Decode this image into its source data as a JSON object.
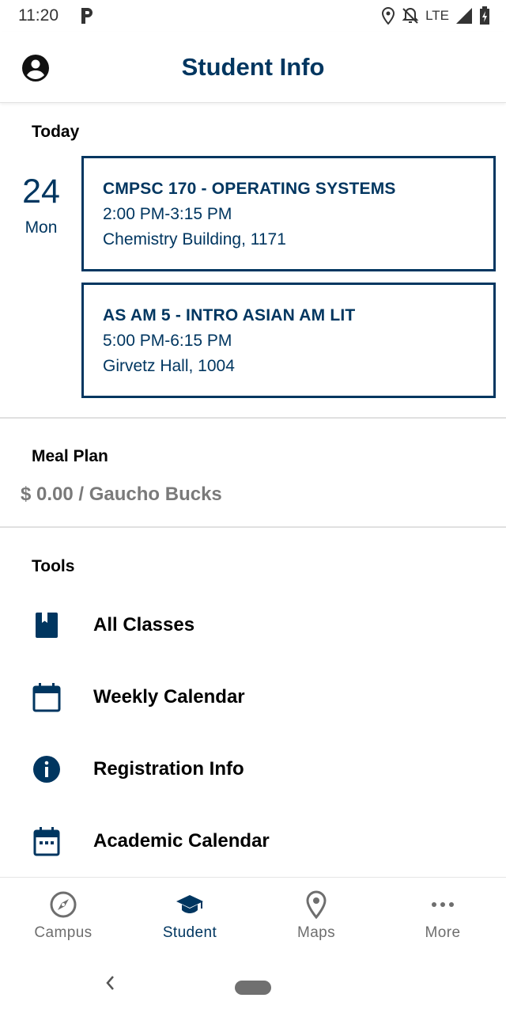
{
  "status_bar": {
    "time": "11:20",
    "network": "LTE"
  },
  "app_bar": {
    "title": "Student Info"
  },
  "today": {
    "heading": "Today",
    "date_number": "24",
    "date_day": "Mon",
    "classes": [
      {
        "title": "CMPSC 170 - OPERATING SYSTEMS",
        "time": "2:00 PM-3:15 PM",
        "location": "Chemistry Building, 1171"
      },
      {
        "title": "AS AM 5 - INTRO ASIAN AM LIT",
        "time": "5:00 PM-6:15 PM",
        "location": "Girvetz Hall, 1004"
      }
    ]
  },
  "meal_plan": {
    "heading": "Meal Plan",
    "balance": "$  0.00 / Gaucho Bucks"
  },
  "tools": {
    "heading": "Tools",
    "items": [
      {
        "label": "All Classes",
        "icon": "book-icon"
      },
      {
        "label": "Weekly Calendar",
        "icon": "calendar-icon"
      },
      {
        "label": "Registration Info",
        "icon": "info-icon"
      },
      {
        "label": "Academic Calendar",
        "icon": "calendar-dots-icon"
      }
    ]
  },
  "bottom_nav": {
    "items": [
      {
        "label": "Campus",
        "icon": "compass-icon",
        "active": false
      },
      {
        "label": "Student",
        "icon": "graduation-cap-icon",
        "active": true
      },
      {
        "label": "Maps",
        "icon": "map-pin-icon",
        "active": false
      },
      {
        "label": "More",
        "icon": "more-dots-icon",
        "active": false
      }
    ]
  },
  "colors": {
    "primary": "#003660",
    "muted": "#7a7a7a",
    "nav_inactive": "#6e6e6e"
  }
}
